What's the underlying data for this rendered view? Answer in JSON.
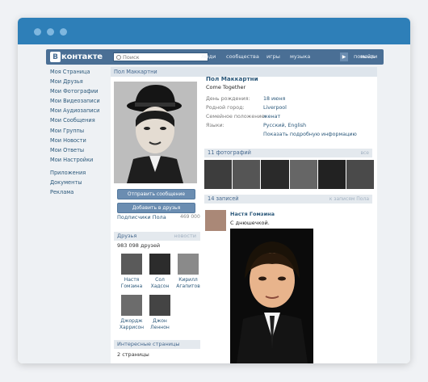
{
  "site": {
    "logo_mark": "В",
    "logo_text": "контакте",
    "search_placeholder": "Поиск",
    "nav": [
      "люди",
      "сообщества",
      "игры",
      "музыка",
      "помощь",
      "выйти"
    ]
  },
  "left_menu": {
    "group1": [
      "Моя Страница",
      "Мои Друзья",
      "Мои Фотографии",
      "Мои Видеозаписи",
      "Мои Аудиозаписи",
      "Мои Сообщения",
      "Мои Группы",
      "Мои Новости",
      "Мои Ответы",
      "Мои Настройки"
    ],
    "group2": [
      "Приложения",
      "Документы",
      "Реклама"
    ]
  },
  "profile": {
    "header_name": "Пол Маккартни",
    "name": "Пол Маккартни",
    "status": "Come Together",
    "info": [
      {
        "key": "День рождения:",
        "value": "18 июня"
      },
      {
        "key": "Родной город:",
        "value": "Liverpool"
      },
      {
        "key": "Семейное положение:",
        "value": "женат"
      },
      {
        "key": "Языки:",
        "value": "Русский, English"
      }
    ],
    "more_info": "Показать подробную информацию",
    "send_message": "Отправить сообщение",
    "add_friend": "Добавить в друзья",
    "subscribers_label": "Подписчики Пола",
    "subscribers_count": "469 000"
  },
  "friends": {
    "title": "Друзья",
    "link": "новости",
    "count": "983 098 друзей",
    "items": [
      {
        "first": "Настя",
        "last": "Гомзина"
      },
      {
        "first": "Сол",
        "last": "Хадсон"
      },
      {
        "first": "Кирилл",
        "last": "Агапитов"
      },
      {
        "first": "Джордж",
        "last": "Харрисон"
      },
      {
        "first": "Джон",
        "last": "Леннон"
      }
    ]
  },
  "interesting": {
    "title": "Интересные страницы",
    "count": "2 страницы"
  },
  "photos": {
    "title": "11 фотографий",
    "link": "все"
  },
  "wall": {
    "title": "14 записей",
    "link": "к записям Пола",
    "post_author": "Настя Гомзина",
    "post_text": "С днюшечкой."
  }
}
